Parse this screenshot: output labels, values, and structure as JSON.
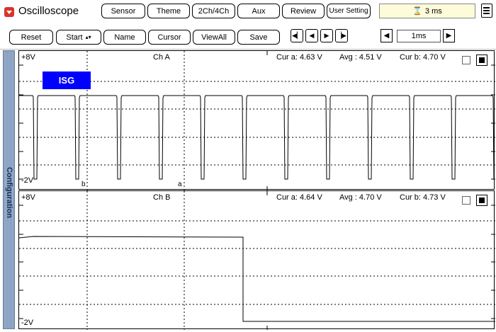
{
  "app": {
    "title": "Oscilloscope",
    "timebase_display": "3 ms"
  },
  "toolbar_row1": {
    "sensor": "Sensor",
    "theme": "Theme",
    "channels": "2Ch/4Ch",
    "aux": "Aux",
    "review": "Review",
    "user_setting": "User Setting"
  },
  "toolbar_row2": {
    "reset": "Reset",
    "start": "Start",
    "start_arrow": "▴▾",
    "name": "Name",
    "cursor": "Cursor",
    "view_all": "ViewAll",
    "save": "Save",
    "step_value": "1ms"
  },
  "side_panel": {
    "label": "Configuration"
  },
  "channel_a": {
    "name": "Ch A",
    "top_scale": "+8V",
    "bottom_scale": "-2V",
    "cur_a": "Cur a: 4.63 V",
    "avg": "Avg  : 4.51 V",
    "cur_b": "Cur b: 4.70 V",
    "tag": "ISG",
    "marker_b": "b",
    "marker_a": "a"
  },
  "channel_b": {
    "name": "Ch B",
    "top_scale": "+8V",
    "bottom_scale": "-2V",
    "cur_a": "Cur a: 4.64 V",
    "avg": "Avg  : 4.70 V",
    "cur_b": "Cur b: 4.73 V"
  },
  "colors": {
    "tag_bg": "#0000ff",
    "side_panel": "#8aa2c0",
    "app_icon": "#d9342b",
    "timebox_bg": "#fdfbd9"
  }
}
